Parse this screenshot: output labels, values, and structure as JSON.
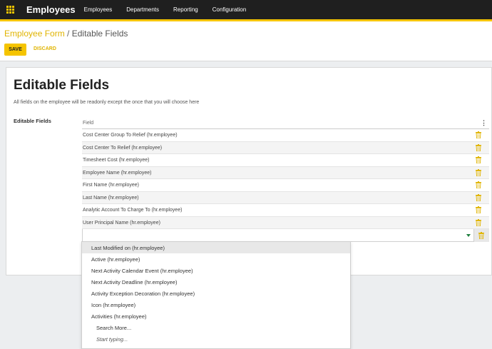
{
  "topbar": {
    "brand": "Employees",
    "menu": [
      "Employees",
      "Departments",
      "Reporting",
      "Configuration"
    ]
  },
  "breadcrumb": {
    "parent": "Employee Form",
    "separator": " / ",
    "current": "Editable Fields"
  },
  "buttons": {
    "save": "SAVE",
    "discard": "DISCARD"
  },
  "form": {
    "title": "Editable Fields",
    "description": "All fields on the employee will be readonly except the once that you will choose here",
    "field_label": "Editable Fields",
    "column_header": "Field",
    "rows": [
      "Cost Center Group To Relief (hr.employee)",
      "Cost Center To Relief (hr.employee)",
      "Timesheet Cost (hr.employee)",
      "Employee Name (hr.employee)",
      "First Name (hr.employee)",
      "Last Name (hr.employee)",
      "Analytic Account To Charge To (hr.employee)",
      "User Principal Name (hr.employee)"
    ],
    "input_value": ""
  },
  "dropdown": {
    "options": [
      "Last Modified on (hr.employee)",
      "Active (hr.employee)",
      "Next Activity Calendar Event (hr.employee)",
      "Next Activity Deadline (hr.employee)",
      "Activity Exception Decoration (hr.employee)",
      "Icon (hr.employee)",
      "Activities (hr.employee)"
    ],
    "search_more": "Search More...",
    "start_typing": "Start typing..."
  },
  "colors": {
    "accent": "#f5c400",
    "topbar": "#1f1f1f",
    "trash": "#e0b400"
  },
  "icons": {
    "apps": "apps-grid-icon",
    "trash": "trash-icon",
    "kebab": "kebab-menu-icon",
    "caret": "caret-down-icon"
  }
}
